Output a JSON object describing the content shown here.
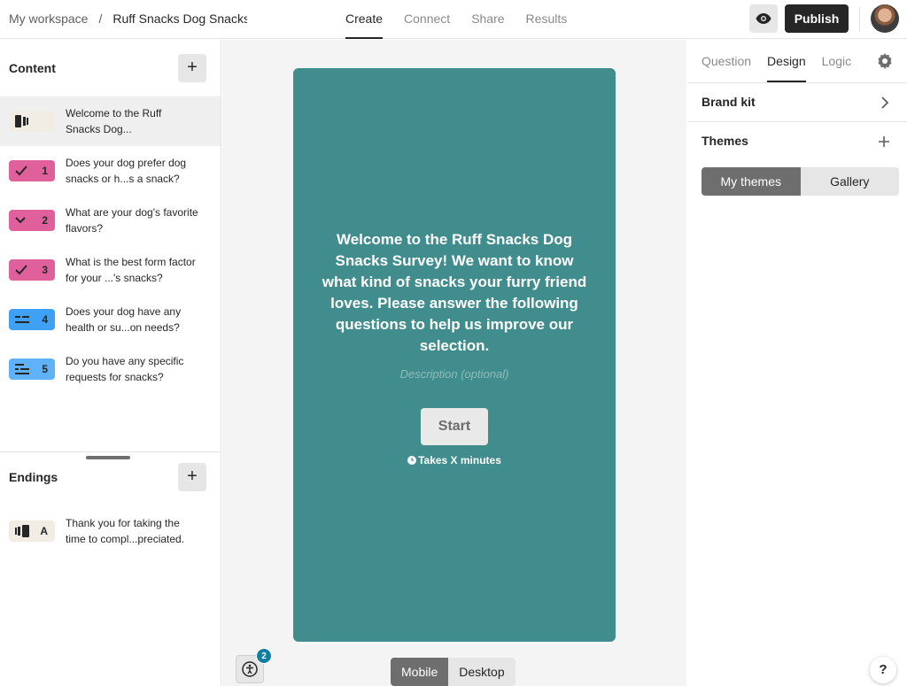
{
  "breadcrumb": {
    "workspace": "My workspace",
    "separator": "/",
    "form_name": "Ruff Snacks Dog Snacks Survey"
  },
  "main_tabs": [
    {
      "label": "Create"
    },
    {
      "label": "Connect"
    },
    {
      "label": "Share"
    },
    {
      "label": "Results"
    }
  ],
  "header": {
    "publish_label": "Publish",
    "preview_icon": "eye-icon"
  },
  "content": {
    "title": "Content",
    "add_icon": "+",
    "items": [
      {
        "badge_icon": "welcome-screen-icon",
        "number": "",
        "color": "#f2ede4",
        "text": "Welcome to the Ruff Snacks Dog..."
      },
      {
        "badge_icon": "checkmark-icon",
        "number": "1",
        "color": "#e0609c",
        "text": "Does your dog prefer dog snacks or h...s a snack?"
      },
      {
        "badge_icon": "chevron-down-icon",
        "number": "2",
        "color": "#e0609c",
        "text": "What are your dog's favorite flavors?"
      },
      {
        "badge_icon": "checkmark-icon",
        "number": "3",
        "color": "#e0609c",
        "text": "What is the best form factor for your ...'s snacks?"
      },
      {
        "badge_icon": "short-text-icon",
        "number": "4",
        "color": "#3fa1f5",
        "text": "Does your dog have any health or su...on needs?"
      },
      {
        "badge_icon": "long-text-icon",
        "number": "5",
        "color": "#5fb2f7",
        "text": "Do you have any specific requests for snacks?"
      }
    ]
  },
  "endings": {
    "title": "Endings",
    "add_icon": "+",
    "items": [
      {
        "badge_icon": "ending-screen-icon",
        "number": "A",
        "color": "#f2ede4",
        "text": "Thank you for taking the time to compl...preciated."
      }
    ]
  },
  "preview": {
    "welcome_text": "Welcome to the Ruff Snacks Dog Snacks Survey! We want to know what kind of snacks your furry friend loves. Please answer the following questions to help us improve our selection.",
    "description_placeholder": "Description (optional)",
    "start_label": "Start",
    "takes_label": "Takes X minutes",
    "card_color": "#418d8e"
  },
  "canvas": {
    "a11y_count": "2",
    "device_toggle": [
      {
        "label": "Mobile"
      },
      {
        "label": "Desktop"
      }
    ]
  },
  "right_panel": {
    "tabs": [
      {
        "label": "Question"
      },
      {
        "label": "Design"
      },
      {
        "label": "Logic"
      }
    ],
    "brand_kit_label": "Brand kit",
    "themes_label": "Themes",
    "theme_toggle": [
      {
        "label": "My themes"
      },
      {
        "label": "Gallery"
      }
    ],
    "help_label": "?"
  }
}
